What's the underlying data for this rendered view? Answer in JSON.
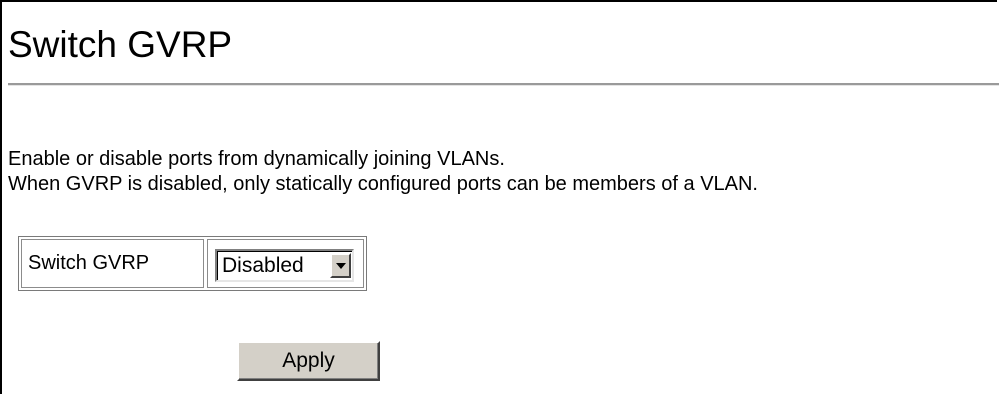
{
  "page": {
    "title": "Switch GVRP",
    "description_lines": [
      "Enable or disable ports from dynamically joining VLANs.",
      "When GVRP is disabled, only statically configured ports can be members of a VLAN."
    ]
  },
  "form": {
    "switch_gvrp_label": "Switch GVRP",
    "switch_gvrp_value": "Disabled",
    "apply_label": "Apply"
  },
  "icons": {
    "select_arrow": "chevron-down-icon"
  }
}
